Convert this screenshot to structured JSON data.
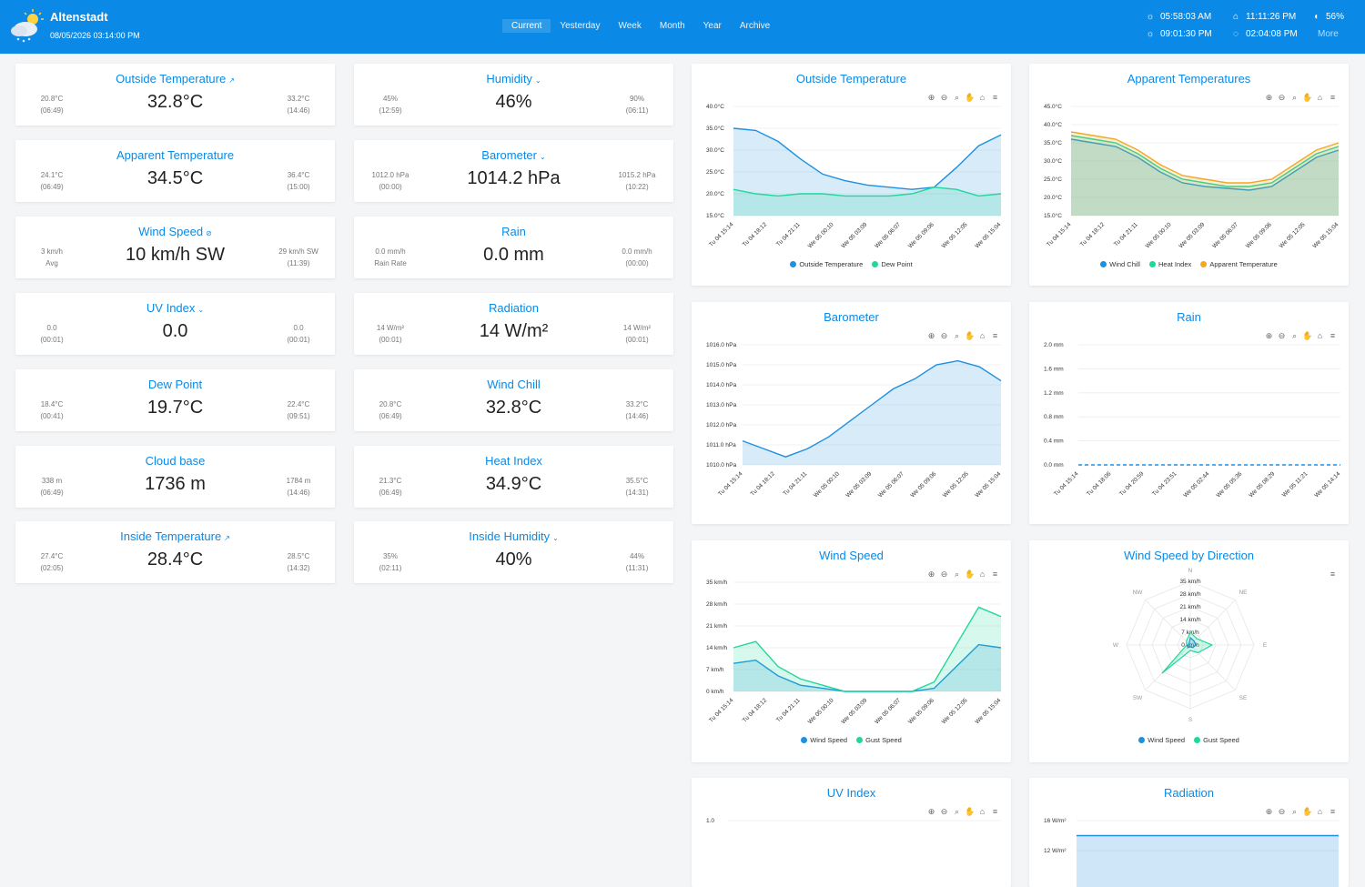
{
  "header": {
    "station": "Altenstadt",
    "datetime": "08/05/2026 03:14:00 PM",
    "nav": [
      "Current",
      "Yesterday",
      "Week",
      "Month",
      "Year",
      "Archive"
    ],
    "sunrise": "05:58:03 AM",
    "sunset": "09:01:30 PM",
    "moonrise": "11:11:26 PM",
    "moonset": "02:04:08 PM",
    "moon_phase": "56%",
    "more": "More"
  },
  "tiles": {
    "outside_temp": {
      "title": "Outside Temperature",
      "value": "32.8°C",
      "min": "20.8°C",
      "min_time": "(06:49)",
      "max": "33.2°C",
      "max_time": "(14:46)"
    },
    "humidity": {
      "title": "Humidity",
      "value": "46%",
      "min": "45%",
      "min_time": "(12:59)",
      "max": "90%",
      "max_time": "(06:11)"
    },
    "apparent_temp": {
      "title": "Apparent Temperature",
      "value": "34.5°C",
      "min": "24.1°C",
      "min_time": "(06:49)",
      "max": "36.4°C",
      "max_time": "(15:00)"
    },
    "barometer": {
      "title": "Barometer",
      "value": "1014.2 hPa",
      "min": "1012.0 hPa",
      "min_time": "(00:00)",
      "max": "1015.2 hPa",
      "max_time": "(10:22)"
    },
    "wind_speed": {
      "title": "Wind Speed",
      "value": "10 km/h SW",
      "min": "3 km/h",
      "min_time": "Avg",
      "max": "29 km/h SW",
      "max_time": "(11:39)"
    },
    "rain": {
      "title": "Rain",
      "value": "0.0 mm",
      "min": "0.0 mm/h",
      "min_time": "Rain Rate",
      "max": "0.0 mm/h",
      "max_time": "(00:00)"
    },
    "uv_index": {
      "title": "UV Index",
      "value": "0.0",
      "min": "0.0",
      "min_time": "(00:01)",
      "max": "0.0",
      "max_time": "(00:01)"
    },
    "radiation": {
      "title": "Radiation",
      "value": "14 W/m²",
      "min": "14 W/m²",
      "min_time": "(00:01)",
      "max": "14 W/m²",
      "max_time": "(00:01)"
    },
    "dew_point": {
      "title": "Dew Point",
      "value": "19.7°C",
      "min": "18.4°C",
      "min_time": "(00:41)",
      "max": "22.4°C",
      "max_time": "(09:51)"
    },
    "wind_chill": {
      "title": "Wind Chill",
      "value": "32.8°C",
      "min": "20.8°C",
      "min_time": "(06:49)",
      "max": "33.2°C",
      "max_time": "(14:46)"
    },
    "cloud_base": {
      "title": "Cloud base",
      "value": "1736 m",
      "min": "338 m",
      "min_time": "(06:49)",
      "max": "1784 m",
      "max_time": "(14:46)"
    },
    "heat_index": {
      "title": "Heat Index",
      "value": "34.9°C",
      "min": "21.3°C",
      "min_time": "(06:49)",
      "max": "35.5°C",
      "max_time": "(14:31)"
    },
    "inside_temp": {
      "title": "Inside Temperature",
      "value": "28.4°C",
      "min": "27.4°C",
      "min_time": "(02:05)",
      "max": "28.5°C",
      "max_time": "(14:32)"
    },
    "inside_humidity": {
      "title": "Inside Humidity",
      "value": "40%",
      "min": "35%",
      "min_time": "(02:11)",
      "max": "44%",
      "max_time": "(11:31)"
    }
  },
  "colors": {
    "accent": "#0a8ae6",
    "series_blue": "#1f8fe0",
    "series_green": "#1fd89a",
    "series_orange": "#f5a623"
  },
  "chart_titles": {
    "outside_temp": "Outside Temperature",
    "apparent": "Apparent Temperatures",
    "barometer": "Barometer",
    "rain": "Rain",
    "wind": "Wind Speed",
    "wind_dir": "Wind Speed by Direction",
    "uv": "UV Index",
    "radiation": "Radiation"
  },
  "chart_data": [
    {
      "type": "line",
      "title": "Outside Temperature",
      "x_ticks": [
        "Tu 04 15:14",
        "Tu 04 18:12",
        "Tu 04 21:11",
        "We 05 00:10",
        "We 05 03:09",
        "We 05 06:07",
        "We 05 09:06",
        "We 05 12:05",
        "We 05 15:04"
      ],
      "y_ticks": [
        "40.0°C",
        "35.0°C",
        "30.0°C",
        "25.0°C",
        "20.0°C",
        "15.0°C"
      ],
      "ylim": [
        15,
        40
      ],
      "series": [
        {
          "name": "Outside Temperature",
          "values": [
            35,
            34.5,
            32,
            28,
            24.5,
            23,
            22,
            21.5,
            21,
            21.5,
            26,
            31,
            33.5
          ]
        },
        {
          "name": "Dew Point",
          "values": [
            21,
            20,
            19.5,
            20,
            20,
            19.5,
            19.5,
            19.5,
            20,
            21.5,
            21,
            19.5,
            20
          ]
        }
      ]
    },
    {
      "type": "line",
      "title": "Apparent Temperatures",
      "x_ticks": [
        "Tu 04 15:14",
        "Tu 04 18:12",
        "Tu 04 21:11",
        "We 05 00:10",
        "We 05 03:09",
        "We 05 06:07",
        "We 05 09:06",
        "We 05 12:05",
        "We 05 15:04"
      ],
      "y_ticks": [
        "45.0°C",
        "40.0°C",
        "35.0°C",
        "30.0°C",
        "25.0°C",
        "20.0°C",
        "15.0°C"
      ],
      "ylim": [
        15,
        45
      ],
      "series": [
        {
          "name": "Wind Chill",
          "values": [
            36,
            35,
            34,
            31,
            27,
            24,
            23,
            22.5,
            22,
            23,
            27,
            31,
            33
          ]
        },
        {
          "name": "Heat Index",
          "values": [
            37,
            36,
            35,
            32,
            28,
            25,
            24,
            23,
            23,
            24,
            28,
            32,
            34
          ]
        },
        {
          "name": "Apparent Temperature",
          "values": [
            38,
            37,
            36,
            33,
            29,
            26,
            25,
            24,
            24,
            25,
            29,
            33,
            35
          ]
        }
      ]
    },
    {
      "type": "area",
      "title": "Barometer",
      "x_ticks": [
        "Tu 04 15:14",
        "Tu 04 18:12",
        "Tu 04 21:11",
        "We 05 00:10",
        "We 05 03:09",
        "We 05 06:07",
        "We 05 09:06",
        "We 05 12:05",
        "We 05 15:04"
      ],
      "y_ticks": [
        "1016.0 hPa",
        "1015.0 hPa",
        "1014.0 hPa",
        "1013.0 hPa",
        "1012.0 hPa",
        "1011.0 hPa",
        "1010.0 hPa"
      ],
      "ylim": [
        1010,
        1016
      ],
      "series": [
        {
          "name": "Barometer",
          "values": [
            1011.2,
            1010.8,
            1010.4,
            1010.8,
            1011.4,
            1012.2,
            1013.0,
            1013.8,
            1014.3,
            1015.0,
            1015.2,
            1014.9,
            1014.2
          ]
        }
      ]
    },
    {
      "type": "line",
      "title": "Rain",
      "x_ticks": [
        "Tu 04 15:14",
        "Tu 04 18:06",
        "Tu 04 20:59",
        "Tu 04 23:51",
        "We 05 02:44",
        "We 05 05:36",
        "We 05 08:29",
        "We 05 11:21",
        "We 05 14:14"
      ],
      "y_ticks": [
        "2.0 mm",
        "1.6 mm",
        "1.2 mm",
        "0.8 mm",
        "0.4 mm",
        "0.0 mm"
      ],
      "ylim": [
        0,
        2
      ],
      "series": [
        {
          "name": "Rain",
          "values": [
            0,
            0,
            0,
            0,
            0,
            0,
            0,
            0,
            0,
            0,
            0,
            0,
            0
          ]
        }
      ]
    },
    {
      "type": "line",
      "title": "Wind Speed",
      "x_ticks": [
        "Tu 04 15:14",
        "Tu 04 18:12",
        "Tu 04 21:11",
        "We 05 00:10",
        "We 05 03:09",
        "We 05 06:07",
        "We 05 09:06",
        "We 05 12:05",
        "We 05 15:04"
      ],
      "y_ticks": [
        "35 km/h",
        "28 km/h",
        "21 km/h",
        "14 km/h",
        "7 km/h",
        "0 km/h"
      ],
      "ylim": [
        0,
        35
      ],
      "series": [
        {
          "name": "Wind Speed",
          "values": [
            9,
            10,
            5,
            2,
            1,
            0,
            0,
            0,
            0,
            1,
            8,
            15,
            14
          ]
        },
        {
          "name": "Gust Speed",
          "values": [
            14,
            16,
            8,
            4,
            2,
            0,
            0,
            0,
            0,
            3,
            15,
            27,
            24
          ]
        }
      ]
    },
    {
      "type": "radar",
      "title": "Wind Speed by Direction",
      "categories": [
        "N",
        "NE",
        "E",
        "SE",
        "S",
        "SW",
        "W",
        "NW"
      ],
      "radial_ticks": [
        "35 km/h",
        "28 km/h",
        "21 km/h",
        "14 km/h",
        "7 km/h",
        "0 km/h"
      ],
      "series": [
        {
          "name": "Wind Speed",
          "values": [
            4,
            3,
            3,
            2,
            1,
            2,
            1,
            1
          ]
        },
        {
          "name": "Gust Speed",
          "values": [
            7,
            5,
            12,
            6,
            3,
            22,
            2,
            3
          ]
        }
      ]
    },
    {
      "type": "line",
      "title": "UV Index",
      "y_ticks": [
        "1.0"
      ]
    },
    {
      "type": "area",
      "title": "Radiation",
      "y_ticks": [
        "16 W/m²",
        "12 W/m²"
      ],
      "ylim": [
        0,
        16
      ],
      "series": [
        {
          "name": "Radiation",
          "values": [
            14,
            14,
            14,
            14,
            14,
            14
          ]
        }
      ]
    }
  ]
}
